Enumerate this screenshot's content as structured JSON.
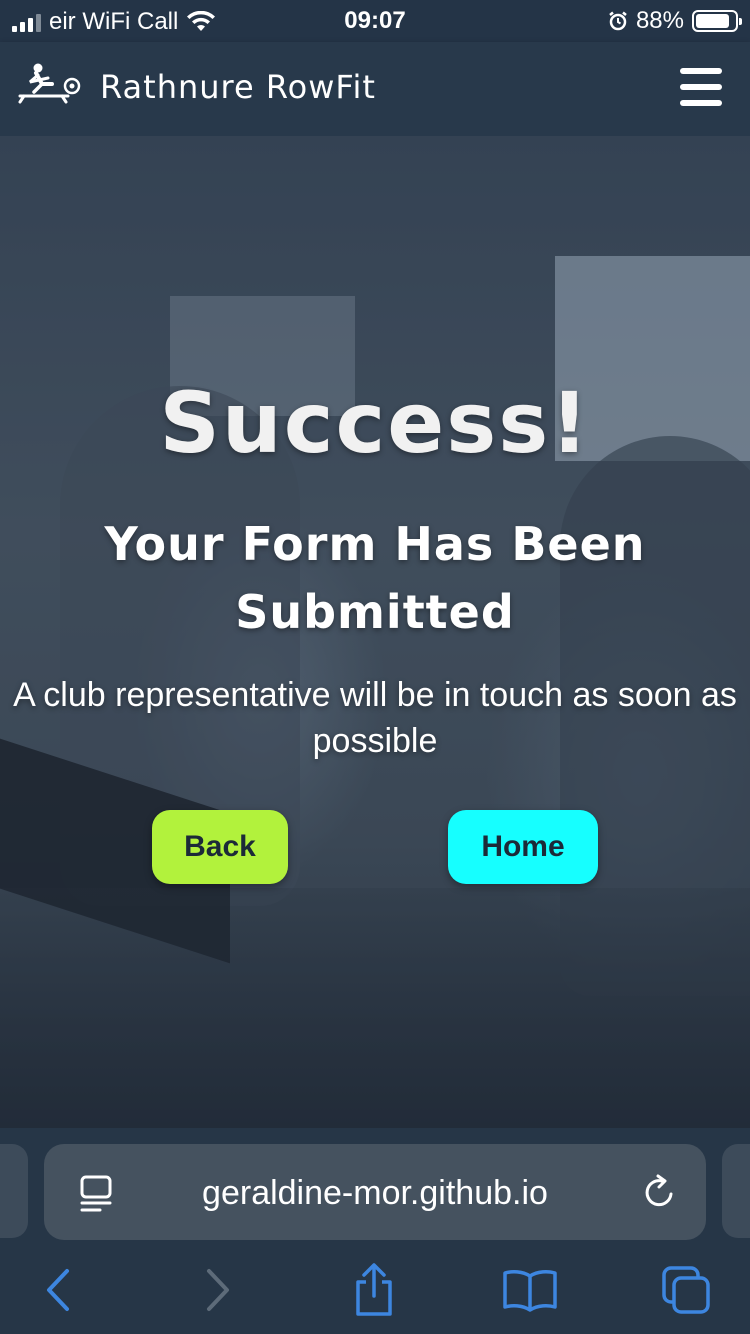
{
  "status_bar": {
    "carrier": "eir WiFi Call",
    "time": "09:07",
    "battery_percent": "88%",
    "battery_level": 0.88
  },
  "navbar": {
    "brand": "Rathnure RowFit"
  },
  "hero": {
    "title": "Success!",
    "subtitle": "Your Form Has Been Submitted",
    "message": "A club representative will be in touch as soon as possible",
    "back_label": "Back",
    "home_label": "Home"
  },
  "browser": {
    "url": "geraldine-mor.github.io"
  },
  "colors": {
    "back_button": "#b2f23c",
    "home_button": "#16ffff",
    "navbar": "#28394b",
    "toolbar_active": "#3d86e0",
    "toolbar_disabled": "#5d6b79"
  }
}
